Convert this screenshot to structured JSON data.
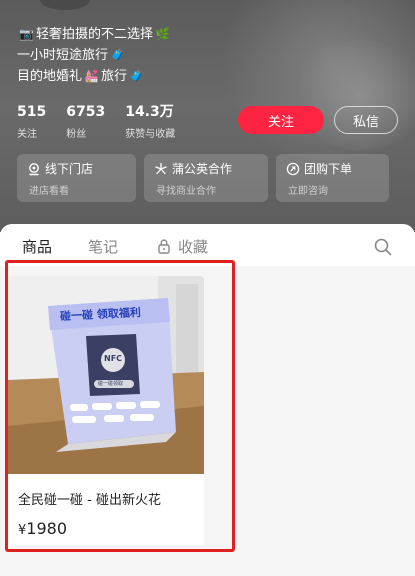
{
  "profile": {
    "bio_lines": [
      {
        "prefix_icon": "camera-emoji",
        "text": "轻奢拍摄的不二选择",
        "suffix_icon": "leaf-emoji"
      },
      {
        "prefix_icon": "",
        "text": "一小时短途旅行",
        "suffix_icon": "suitcase-emoji"
      },
      {
        "prefix_icon": "",
        "text": "目的地婚礼",
        "mid_icon": "wedding-emoji",
        "text2": "旅行",
        "suffix_icon": "suitcase-emoji"
      }
    ],
    "stats": [
      {
        "value": "515",
        "label": "关注"
      },
      {
        "value": "6753",
        "label": "粉丝"
      },
      {
        "value": "14.3万",
        "label": "获赞与收藏"
      }
    ],
    "follow_label": "关注",
    "message_label": "私信"
  },
  "service_cards": [
    {
      "title": "线下门店",
      "subtitle": "进店看看",
      "icon": "store-location-icon"
    },
    {
      "title": "蒲公英合作",
      "subtitle": "寻找商业合作",
      "icon": "dandelion-icon"
    },
    {
      "title": "团购下单",
      "subtitle": "立即咨询",
      "icon": "link-icon"
    }
  ],
  "tabs": [
    {
      "label": "商品",
      "active": true
    },
    {
      "label": "笔记",
      "active": false
    },
    {
      "label": "收藏",
      "active": false,
      "icon": "lock-icon"
    }
  ],
  "product": {
    "name": "全民碰一碰 - 碰出新火花",
    "currency": "¥",
    "price": "1980",
    "image": {
      "title": "碰一碰 领取福利",
      "chip_label": "NFC",
      "chip_sub": "碰一碰领取",
      "tags": [
        "抖音",
        "快手",
        "小红书",
        "视频号",
        "公众号",
        "点评"
      ]
    }
  },
  "colors": {
    "accent": "#ff2442",
    "highlight": "#e0201f"
  }
}
